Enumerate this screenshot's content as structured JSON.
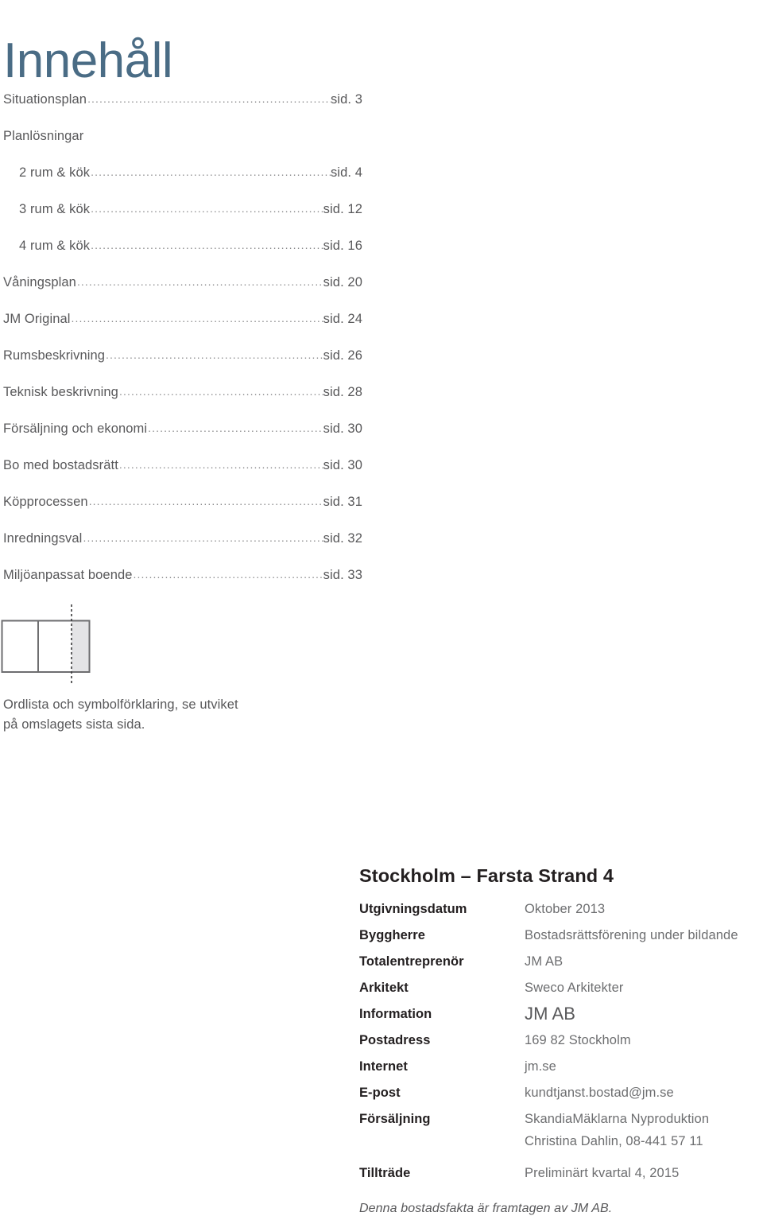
{
  "page": {
    "title": "Innehåll",
    "title_color": "#4A6C85",
    "body_text_color": "#58585A",
    "value_text_color": "#6D6E70"
  },
  "toc": {
    "entries": [
      {
        "label": "Situationsplan",
        "prefix": "sid.",
        "page": "3",
        "indent": false,
        "leader": true
      },
      {
        "label": "Planlösningar",
        "prefix": "",
        "page": "",
        "indent": false,
        "leader": false
      },
      {
        "label": "2 rum & kök",
        "prefix": "sid.",
        "page": "4",
        "indent": true,
        "leader": true
      },
      {
        "label": "3 rum & kök",
        "prefix": "sid.",
        "page": "12",
        "indent": true,
        "leader": true
      },
      {
        "label": "4 rum & kök",
        "prefix": "sid.",
        "page": "16",
        "indent": true,
        "leader": true
      },
      {
        "label": "Våningsplan",
        "prefix": "sid.",
        "page": "20",
        "indent": false,
        "leader": true
      },
      {
        "label": "JM Original",
        "prefix": "sid.",
        "page": "24",
        "indent": false,
        "leader": true
      },
      {
        "label": "Rumsbeskrivning",
        "prefix": "sid.",
        "page": "26",
        "indent": false,
        "leader": true
      },
      {
        "label": "Teknisk beskrivning",
        "prefix": "sid.",
        "page": "28",
        "indent": false,
        "leader": true
      },
      {
        "label": "Försäljning och ekonomi",
        "prefix": "sid.",
        "page": "30",
        "indent": false,
        "leader": true
      },
      {
        "label": "Bo med bostadsrätt",
        "prefix": "sid.",
        "page": "30",
        "indent": false,
        "leader": true
      },
      {
        "label": "Köpprocessen",
        "prefix": "sid.",
        "page": "31",
        "indent": false,
        "leader": true
      },
      {
        "label": "Inredningsval",
        "prefix": "sid.",
        "page": "32",
        "indent": false,
        "leader": true
      },
      {
        "label": "Miljöanpassat boende",
        "prefix": "sid.",
        "page": "33",
        "indent": false,
        "leader": true
      }
    ],
    "leader_char": "."
  },
  "foldout": {
    "icon_name": "foldout-page-diagram",
    "note_line_1": "Ordlista och symbolförklaring, se utviket",
    "note_line_2": "på omslagets sista sida.",
    "shade_color": "#E4E4E6",
    "stroke_color": "#6E6E70"
  },
  "project": {
    "heading": "Stockholm – Farsta Strand 4",
    "rows": [
      {
        "label": "Utgivningsdatum",
        "value": "Oktober 2013",
        "big": false
      },
      {
        "label": "Byggherre",
        "value": "Bostadsrättsförening under bildande",
        "big": false
      },
      {
        "label": "Totalentreprenör",
        "value": "JM AB",
        "big": false
      },
      {
        "label": "Arkitekt",
        "value": "Sweco Arkitekter",
        "big": false
      },
      {
        "label": "Information",
        "value": "JM AB",
        "big": true
      },
      {
        "label": "Postadress",
        "value": "169 82 Stockholm",
        "big": false
      },
      {
        "label": "Internet",
        "value": "jm.se",
        "big": false
      },
      {
        "label": "E-post",
        "value": "kundtjanst.bostad@jm.se",
        "big": false
      },
      {
        "label": "Försäljning",
        "value": "SkandiaMäklarna Nyproduktion\nChristina Dahlin, 08-441 57 11",
        "big": false
      },
      {
        "label": "Tillträde",
        "value": "Preliminärt kvartal 4, 2015",
        "big": false
      }
    ],
    "footnote": "Denna bostadsfakta är framtagen av JM AB."
  }
}
